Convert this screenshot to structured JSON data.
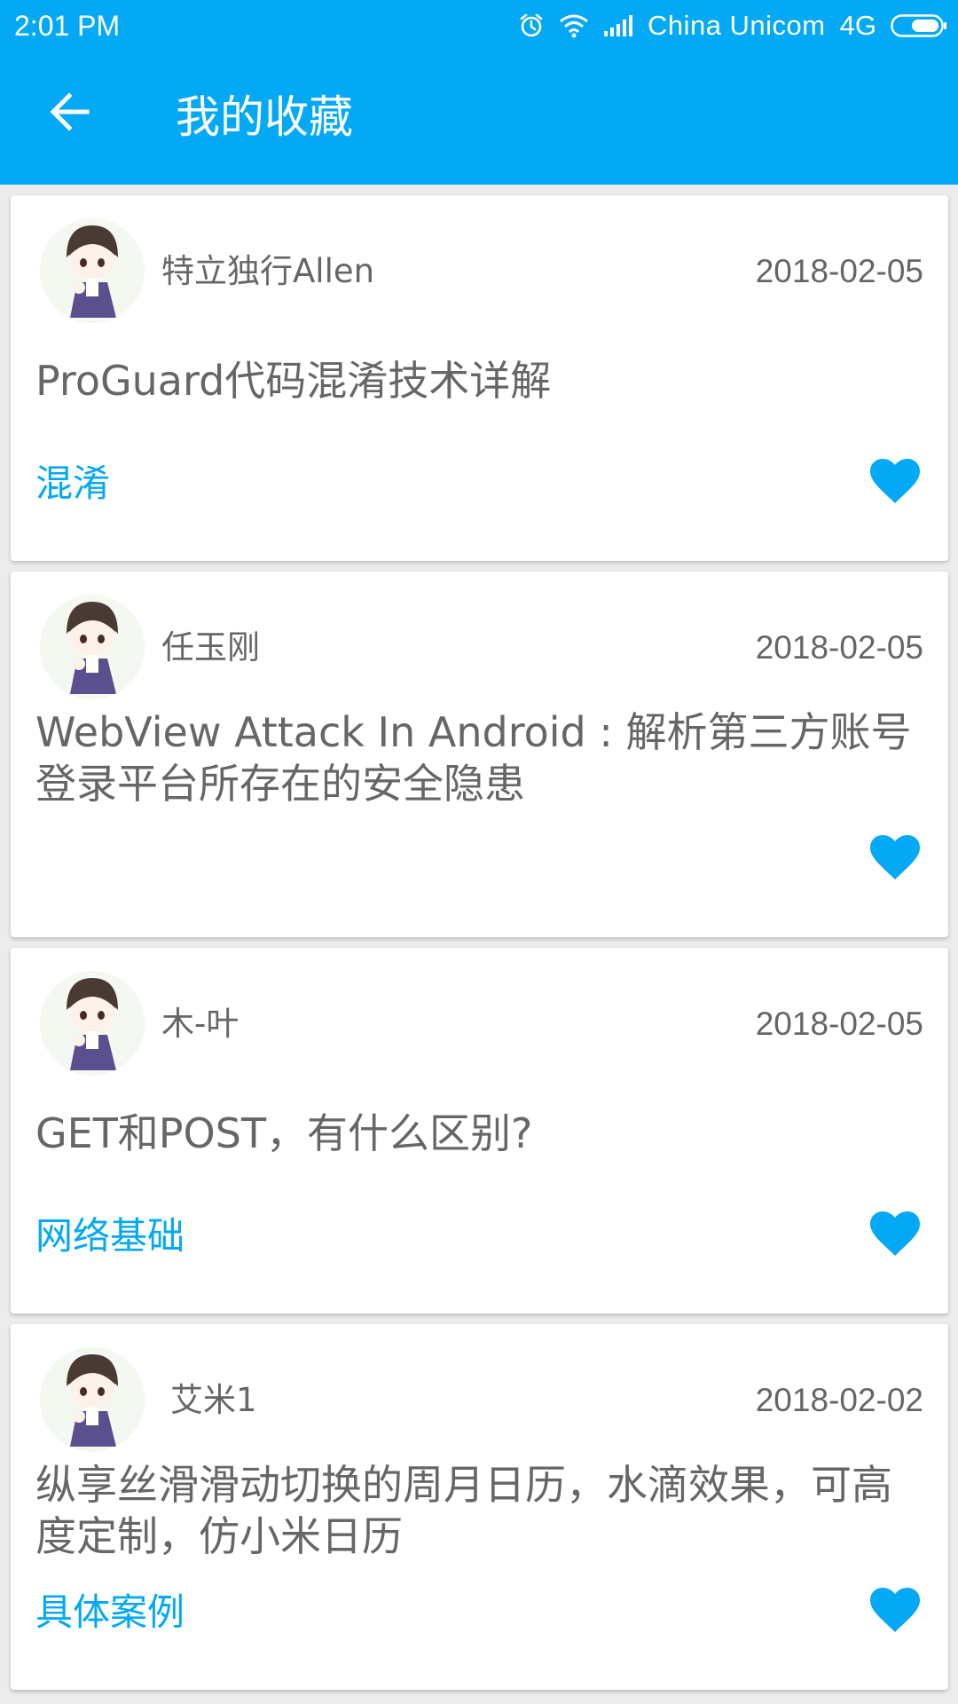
{
  "status_bar": {
    "time": "2:01 PM",
    "carrier": "China Unicom",
    "network": "4G"
  },
  "toolbar": {
    "title": "我的收藏",
    "back_icon": "arrow-back-icon"
  },
  "colors": {
    "primary": "#03a9f4",
    "text_secondary": "#666666",
    "background": "#ececec",
    "card": "#ffffff"
  },
  "favorites": [
    {
      "author": "特立独行Allen",
      "date": "2018-02-05",
      "title": "ProGuard代码混淆技术详解",
      "tag": "混淆",
      "favorite_icon": "heart-filled-icon"
    },
    {
      "author": "任玉刚",
      "date": "2018-02-05",
      "title": "WebView Attack In Android : 解析第三方账号登录平台所存在的安全隐患",
      "tag": "",
      "favorite_icon": "heart-filled-icon"
    },
    {
      "author": "木-叶",
      "date": "2018-02-05",
      "title": "GET和POST，有什么区别?",
      "tag": "网络基础",
      "favorite_icon": "heart-filled-icon"
    },
    {
      "author": "艾米1",
      "date": "2018-02-02",
      "title": "纵享丝滑滑动切换的周月日历，水滴效果，可高度定制，仿小米日历",
      "tag": "具体案例",
      "favorite_icon": "heart-filled-icon"
    }
  ]
}
